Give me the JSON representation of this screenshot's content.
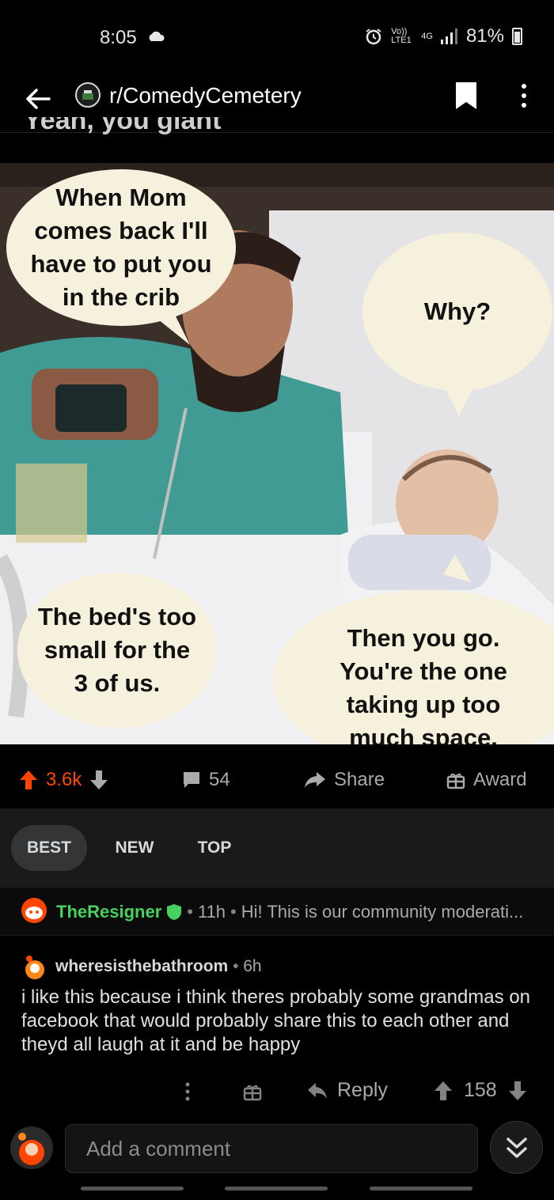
{
  "status": {
    "time": "8:05",
    "volte": "Vo)) LTE1",
    "net": "4G",
    "battery": "81%"
  },
  "header": {
    "subreddit": "r/ComedyCemetery"
  },
  "post": {
    "title_clipped": "Yeah, you giant",
    "bubbles": [
      "When Mom comes back I'll have to put you in the crib",
      "Why?",
      "The bed's too small for the 3 of us.",
      "Then you go. You're the one taking up too much space."
    ]
  },
  "actions": {
    "votes": "3.6k",
    "comments": "54",
    "share": "Share",
    "award": "Award"
  },
  "sort": {
    "tabs": [
      "BEST",
      "NEW",
      "TOP"
    ],
    "active": "BEST"
  },
  "mod_comment": {
    "user": "TheResigner",
    "age": "11h",
    "preview": "Hi! This is our community moderati..."
  },
  "comment": {
    "user": "wheresisthebathroom",
    "age": "6h",
    "body": "i like this because i think theres probably some grandmas on facebook that would probably share this to each other and theyd all laugh at it and be happy",
    "reply": "Reply",
    "score": "158"
  },
  "composer": {
    "placeholder": "Add a comment"
  },
  "colors": {
    "upvote": "#ff4500",
    "mod_green": "#46d160",
    "text": "#d7dadc"
  }
}
